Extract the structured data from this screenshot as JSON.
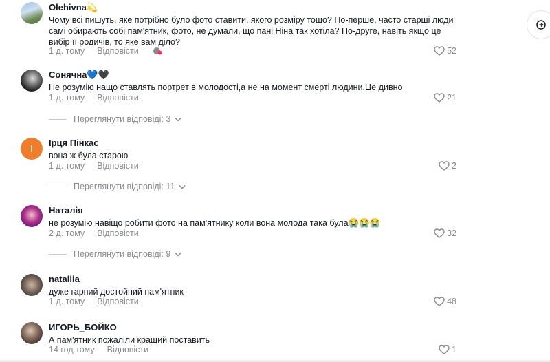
{
  "comments": [
    {
      "username": "Olehivna💫",
      "text": "Чому всі пишуть, яке потрібно було фото ставити, якого розміру тощо? По-перше, часто старші люди самі обирають собі пам'ятник, фото, не думали, що пані Ніна так хотіла? По-друге, навіть якщо це вибір її родичів, то яке вам діло?",
      "time": "1 д. тому",
      "reply_label": "Відповісти",
      "likes": "52"
    },
    {
      "username": "Сонячна💙🖤",
      "text": "Не розумію нащо ставлять портрет в молодості,а не на момент смерті людини.Це дивно",
      "time": "1 д. тому",
      "reply_label": "Відповісти",
      "likes": "21",
      "view_replies": "Переглянути відповіді: 3"
    },
    {
      "username": "Ірця Пінкас",
      "avatar_letter": "I",
      "text": "вона ж була старою",
      "time": "1 д. тому",
      "reply_label": "Відповісти",
      "likes": "2",
      "view_replies": "Переглянути відповіді: 11"
    },
    {
      "username": "Наталія",
      "text": "не розумію навіщо робити фото на пам'ятнику коли вона молода така була😭😭😭",
      "time": "2 д. тому",
      "reply_label": "Відповісти",
      "likes": "32",
      "view_replies": "Переглянути відповіді: 9"
    },
    {
      "username": "nataliia",
      "text": "дуже гарний достойний пам'ятник",
      "time": "1 д. тому",
      "reply_label": "Відповісти",
      "likes": "48"
    },
    {
      "username": "ИГОРЬ_БОЙКО",
      "text": "А пам'ятник пожаліли кращий поставить",
      "time": "14 год тому",
      "reply_label": "Відповісти",
      "likes": "1"
    }
  ],
  "icons": {
    "like": "heart-outline-icon",
    "expand": "chevron-down-icon",
    "side": "share-icon"
  }
}
